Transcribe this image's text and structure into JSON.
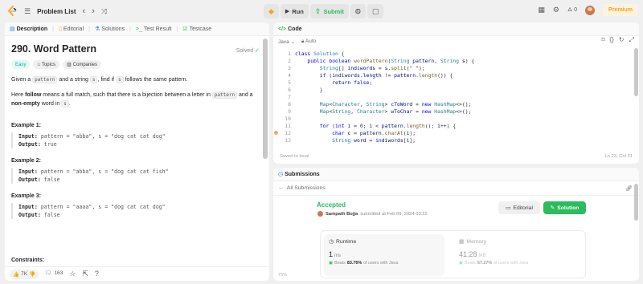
{
  "topbar": {
    "problem_list_label": "Problem List",
    "run_label": "Run",
    "submit_label": "Submit",
    "streak_count": "0",
    "premium_label": "Premium"
  },
  "left_tabs": [
    {
      "label": "Description"
    },
    {
      "label": "Editorial"
    },
    {
      "label": "Solutions"
    },
    {
      "label": "Test Result"
    },
    {
      "label": "Testcase"
    }
  ],
  "problem": {
    "title": "290. Word Pattern",
    "solved_label": "Solved",
    "difficulty": "Easy",
    "tag_topics": "Topics",
    "tag_companies": "Companies",
    "statement_1": {
      "a": "Given a ",
      "b": "pattern",
      "c": " and a string ",
      "d": "s",
      "e": ", find if ",
      "f": "s",
      "g": " follows the same pattern."
    },
    "statement_2": {
      "a": "Here ",
      "b": "follow",
      "c": " means a full match, such that there is a bijection between a letter in ",
      "d": "pattern",
      "e": " and a",
      "f": "non-empty",
      "g": " word in ",
      "h": "s",
      "i": "."
    },
    "examples": [
      {
        "title": "Example 1:",
        "input_label": "Input:",
        "input": "pattern = \"abba\", s = \"dog cat cat dog\"",
        "output_label": "Output:",
        "output": "true"
      },
      {
        "title": "Example 2:",
        "input_label": "Input:",
        "input": "pattern = \"abba\", s = \"dog cat cat fish\"",
        "output_label": "Output:",
        "output": "false"
      },
      {
        "title": "Example 3:",
        "input_label": "Input:",
        "input": "pattern = \"aaaa\", s = \"dog cat cat dog\"",
        "output_label": "Output:",
        "output": "false"
      }
    ],
    "constraints_label": "Constraints:"
  },
  "left_footer": {
    "likes": "7K",
    "comments": "163"
  },
  "code_panel": {
    "title": "Code",
    "language": "Java",
    "auto_label": "Auto",
    "saved_label": "Saved to local",
    "cursor_pos": "Ln 23, Col 31",
    "lines": [
      {
        "n": "1",
        "t": "class Solution {"
      },
      {
        "n": "2",
        "t": "    public boolean wordPattern(String pattern, String s) {"
      },
      {
        "n": "3",
        "t": "        String[] indiwords = s.split(\" \");"
      },
      {
        "n": "4",
        "t": "        if (indiwords.length != pattern.length()) {"
      },
      {
        "n": "5",
        "t": "            return false;"
      },
      {
        "n": "6",
        "t": "        }"
      },
      {
        "n": "7",
        "t": ""
      },
      {
        "n": "8",
        "t": "        Map<Character, String> cToWord = new HashMap<>();"
      },
      {
        "n": "9",
        "t": "        Map<String, Character> wToChar = new HashMap<>();"
      },
      {
        "n": "10",
        "t": ""
      },
      {
        "n": "11",
        "t": "        for (int i = 0; i < pattern.length(); i++) {"
      },
      {
        "n": "12",
        "t": "            char c = pattern.charAt(i);"
      },
      {
        "n": "13",
        "t": "            String word = indiwords[i];"
      }
    ]
  },
  "submissions": {
    "title": "Submissions",
    "back_label": "All Submissions",
    "status": "Accepted",
    "user": "Sampath Bojja",
    "submitted_text": "submitted at Feb 09, 2024 03:22",
    "editorial_label": "Editorial",
    "solution_label": "Solution",
    "runtime_label": "Runtime",
    "runtime_value": "1",
    "runtime_unit": "ms",
    "runtime_beats_prefix": "Beats",
    "runtime_beats": "83.76%",
    "runtime_beats_suffix": "of users with Java",
    "memory_label": "Memory",
    "memory_value": "41.28",
    "memory_unit": "MB",
    "memory_beats_prefix": "Beats",
    "memory_beats": "57.27%",
    "memory_beats_suffix": "of users with Java",
    "axis_pct": "75%"
  },
  "colors": {
    "accent_green": "#2cbb5d",
    "premium_orange": "#ffa116",
    "easy_teal": "#00b8a3",
    "description_tab_icon": "#2e7bea"
  },
  "icons": [
    "logo-icon",
    "list-icon",
    "chevron-left-icon",
    "chevron-right-icon",
    "shuffle-icon",
    "bug-icon",
    "play-icon",
    "upload-icon",
    "timer-icon",
    "note-icon",
    "grid-icon",
    "settings-icon",
    "fire-icon",
    "check-circle-icon",
    "tag-icon",
    "building-icon",
    "thumb-up-icon",
    "thumb-down-icon",
    "comment-icon",
    "star-icon",
    "share-icon",
    "help-icon",
    "code-icon",
    "lock-icon",
    "bookmark-icon",
    "braces-icon",
    "reset-icon",
    "expand-icon",
    "link-icon",
    "clock-icon",
    "beaker-icon",
    "flask-icon"
  ]
}
